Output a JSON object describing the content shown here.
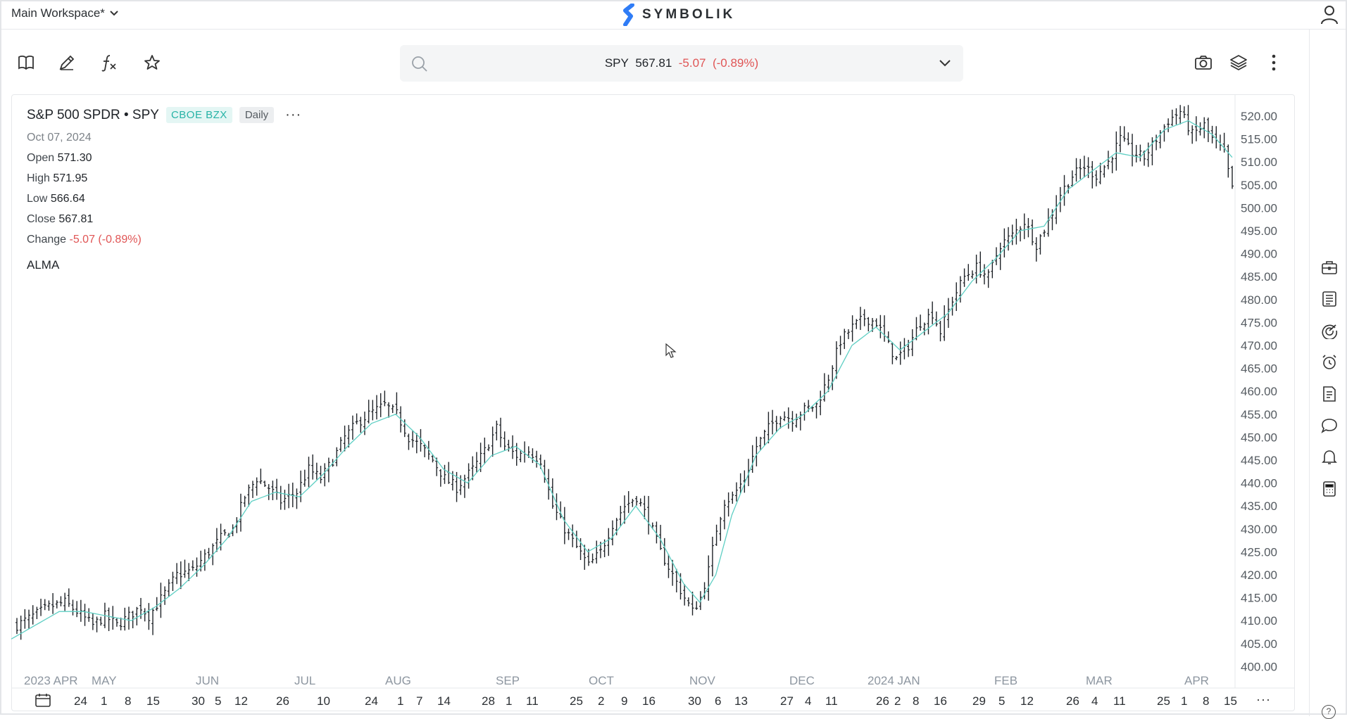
{
  "workspace": {
    "label": "Main Workspace*"
  },
  "brand": {
    "name": "SYMBOLIK"
  },
  "toolbar": {
    "tools": [
      "book-icon",
      "pencil-icon",
      "function-icon",
      "star-icon"
    ],
    "right_tools": [
      "camera-icon",
      "layers-icon",
      "more-vertical-icon"
    ]
  },
  "symbol_bar": {
    "symbol": "SPY",
    "last": "567.81",
    "change": "-5.07",
    "change_pct": "(-0.89%)"
  },
  "legend": {
    "name": "S&P 500 SPDR • SPY",
    "exchange": "CBOE BZX",
    "period": "Daily",
    "more": "···",
    "date": "Oct 07, 2024",
    "open_label": "Open",
    "open": "571.30",
    "high_label": "High",
    "high": "571.95",
    "low_label": "Low",
    "low": "566.64",
    "close_label": "Close",
    "close": "567.81",
    "change_label": "Change",
    "change": "-5.07 (-0.89%)",
    "indicator": "ALMA"
  },
  "right_rail": {
    "icons": [
      "briefcase-icon",
      "news-list-icon",
      "radar-icon",
      "alarm-clock-icon",
      "notes-icon",
      "chat-icon",
      "bell-icon",
      "calculator-icon"
    ]
  },
  "colors": {
    "bar": "#1f2328",
    "alma": "#5fcfc4",
    "negative": "#e05555",
    "axis_text": "#555b61",
    "month_text": "#8d96a0"
  },
  "chart_data": {
    "type": "ohlc",
    "ylim": [
      398,
      524
    ],
    "y_ticks": [
      "520.00",
      "515.00",
      "510.00",
      "505.00",
      "500.00",
      "495.00",
      "490.00",
      "485.00",
      "480.00",
      "475.00",
      "470.00",
      "465.00",
      "460.00",
      "455.00",
      "450.00",
      "445.00",
      "440.00",
      "435.00",
      "430.00",
      "425.00",
      "420.00",
      "415.00",
      "410.00",
      "405.00",
      "400.00"
    ],
    "month_labels": [
      "2023 APR",
      "MAY",
      "JUN",
      "JUL",
      "AUG",
      "SEP",
      "OCT",
      "NOV",
      "DEC",
      "2024 JAN",
      "FEB",
      "MAR",
      "APR"
    ],
    "day_labels": [
      "24",
      "1",
      "8",
      "15",
      "30",
      "5",
      "12",
      "26",
      "10",
      "24",
      "1",
      "7",
      "14",
      "28",
      "1",
      "11",
      "25",
      "2",
      "9",
      "16",
      "30",
      "6",
      "13",
      "27",
      "4",
      "11",
      "26",
      "2",
      "8",
      "16",
      "29",
      "5",
      "12",
      "26",
      "4",
      "11",
      "25",
      "1",
      "8",
      "15"
    ],
    "close_path": [
      [
        0,
        409
      ],
      [
        4,
        411
      ],
      [
        8,
        413
      ],
      [
        12,
        414
      ],
      [
        15,
        412
      ],
      [
        19,
        409
      ],
      [
        22,
        411
      ],
      [
        25,
        409
      ],
      [
        28,
        411
      ],
      [
        31,
        413
      ],
      [
        33,
        411
      ],
      [
        37,
        416
      ],
      [
        40,
        420
      ],
      [
        44,
        421
      ],
      [
        48,
        425
      ],
      [
        51,
        428
      ],
      [
        54,
        430
      ],
      [
        57,
        437
      ],
      [
        60,
        441
      ],
      [
        63,
        439
      ],
      [
        66,
        436
      ],
      [
        70,
        438
      ],
      [
        73,
        443
      ],
      [
        76,
        441
      ],
      [
        79,
        445
      ],
      [
        82,
        450
      ],
      [
        85,
        453
      ],
      [
        88,
        455
      ],
      [
        92,
        457
      ],
      [
        95,
        455
      ],
      [
        98,
        450
      ],
      [
        101,
        448
      ],
      [
        104,
        445
      ],
      [
        107,
        441
      ],
      [
        110,
        439
      ],
      [
        114,
        443
      ],
      [
        117,
        447
      ],
      [
        120,
        452
      ],
      [
        122,
        448
      ],
      [
        125,
        446
      ],
      [
        128,
        447
      ],
      [
        131,
        445
      ],
      [
        134,
        435
      ],
      [
        137,
        430
      ],
      [
        140,
        426
      ],
      [
        143,
        422
      ],
      [
        146,
        425
      ],
      [
        149,
        431
      ],
      [
        152,
        435
      ],
      [
        155,
        437
      ],
      [
        158,
        432
      ],
      [
        161,
        425
      ],
      [
        164,
        420
      ],
      [
        167,
        415
      ],
      [
        169,
        412
      ],
      [
        171,
        415
      ],
      [
        173,
        421
      ],
      [
        175,
        430
      ],
      [
        177,
        436
      ],
      [
        179,
        437
      ],
      [
        182,
        441
      ],
      [
        185,
        448
      ],
      [
        188,
        452
      ],
      [
        191,
        455
      ],
      [
        194,
        454
      ],
      [
        197,
        456
      ],
      [
        200,
        457
      ],
      [
        203,
        463
      ],
      [
        206,
        471
      ],
      [
        209,
        474
      ],
      [
        212,
        476
      ],
      [
        215,
        475
      ],
      [
        218,
        470
      ],
      [
        220,
        467
      ],
      [
        223,
        470
      ],
      [
        226,
        475
      ],
      [
        229,
        477
      ],
      [
        231,
        473
      ],
      [
        234,
        480
      ],
      [
        237,
        485
      ],
      [
        240,
        487
      ],
      [
        243,
        485
      ],
      [
        246,
        492
      ],
      [
        249,
        494
      ],
      [
        252,
        497
      ],
      [
        255,
        492
      ],
      [
        258,
        497
      ],
      [
        261,
        503
      ],
      [
        264,
        507
      ],
      [
        267,
        509
      ],
      [
        270,
        507
      ],
      [
        273,
        510
      ],
      [
        276,
        515
      ],
      [
        279,
        512
      ],
      [
        282,
        511
      ],
      [
        285,
        515
      ],
      [
        288,
        519
      ],
      [
        291,
        521
      ],
      [
        294,
        516
      ],
      [
        297,
        518
      ],
      [
        299,
        515
      ],
      [
        302,
        512
      ],
      [
        304,
        504
      ]
    ],
    "alma_path": [
      [
        0,
        406
      ],
      [
        6,
        409
      ],
      [
        12,
        412
      ],
      [
        18,
        412
      ],
      [
        24,
        411
      ],
      [
        30,
        410
      ],
      [
        36,
        413
      ],
      [
        42,
        417
      ],
      [
        48,
        422
      ],
      [
        54,
        428
      ],
      [
        60,
        436
      ],
      [
        66,
        438
      ],
      [
        72,
        437
      ],
      [
        78,
        442
      ],
      [
        84,
        448
      ],
      [
        90,
        453
      ],
      [
        96,
        455
      ],
      [
        102,
        450
      ],
      [
        108,
        443
      ],
      [
        114,
        440
      ],
      [
        120,
        446
      ],
      [
        126,
        448
      ],
      [
        132,
        444
      ],
      [
        138,
        432
      ],
      [
        144,
        425
      ],
      [
        150,
        428
      ],
      [
        156,
        435
      ],
      [
        162,
        428
      ],
      [
        168,
        418
      ],
      [
        172,
        414
      ],
      [
        176,
        420
      ],
      [
        180,
        433
      ],
      [
        186,
        446
      ],
      [
        192,
        452
      ],
      [
        198,
        455
      ],
      [
        204,
        460
      ],
      [
        210,
        470
      ],
      [
        216,
        474
      ],
      [
        222,
        469
      ],
      [
        228,
        473
      ],
      [
        234,
        477
      ],
      [
        240,
        484
      ],
      [
        246,
        489
      ],
      [
        252,
        495
      ],
      [
        258,
        496
      ],
      [
        264,
        504
      ],
      [
        270,
        508
      ],
      [
        276,
        512
      ],
      [
        282,
        511
      ],
      [
        288,
        517
      ],
      [
        294,
        519
      ],
      [
        300,
        516
      ],
      [
        306,
        510
      ]
    ]
  }
}
